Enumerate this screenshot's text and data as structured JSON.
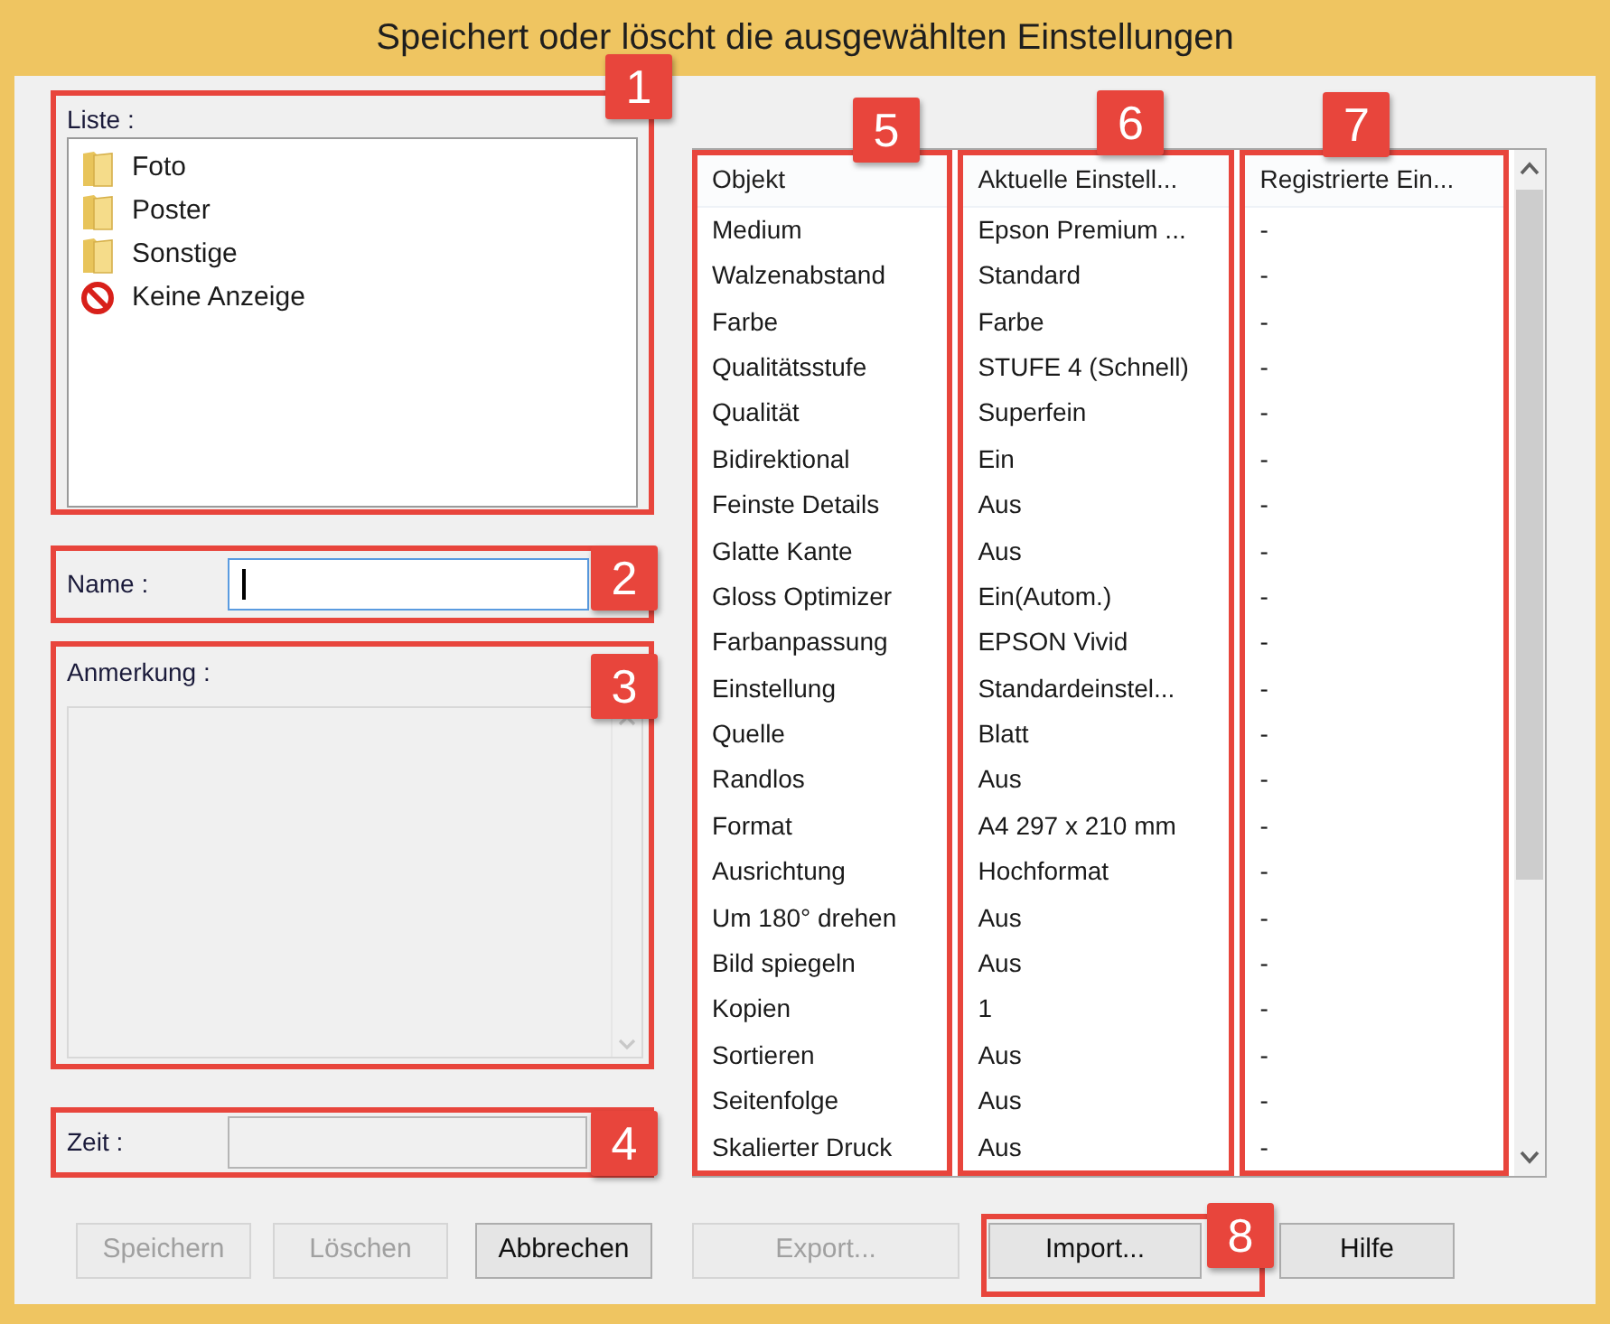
{
  "window": {
    "title": "Speichert oder löscht die ausgewählten Einstellungen"
  },
  "list": {
    "label": "Liste :",
    "items": [
      {
        "label": "Foto",
        "kind": "folder"
      },
      {
        "label": "Poster",
        "kind": "folder"
      },
      {
        "label": "Sonstige",
        "kind": "folder"
      },
      {
        "label": "Keine Anzeige",
        "kind": "blocked"
      }
    ]
  },
  "name": {
    "label": "Name :",
    "focused": true
  },
  "note": {
    "label": "Anmerkung :",
    "disabled": true
  },
  "time": {
    "label": "Zeit :",
    "disabled": true
  },
  "table": {
    "columns": [
      "Objekt",
      "Aktuelle Einstell...",
      "Registrierte Ein..."
    ],
    "rows": [
      [
        "Medium",
        "Epson Premium ...",
        "-"
      ],
      [
        "Walzenabstand",
        "Standard",
        "-"
      ],
      [
        "Farbe",
        "Farbe",
        "-"
      ],
      [
        "Qualitätsstufe",
        "STUFE 4 (Schnell)",
        "-"
      ],
      [
        "Qualität",
        "Superfein",
        "-"
      ],
      [
        "Bidirektional",
        "Ein",
        "-"
      ],
      [
        "Feinste Details",
        "Aus",
        "-"
      ],
      [
        "Glatte Kante",
        "Aus",
        "-"
      ],
      [
        "Gloss Optimizer",
        "Ein(Autom.)",
        "-"
      ],
      [
        "Farbanpassung",
        "EPSON Vivid",
        "-"
      ],
      [
        "Einstellung",
        "Standardeinstel...",
        "-"
      ],
      [
        "Quelle",
        "Blatt",
        "-"
      ],
      [
        "Randlos",
        "Aus",
        "-"
      ],
      [
        "Format",
        "A4 297 x 210 mm",
        "-"
      ],
      [
        "Ausrichtung",
        "Hochformat",
        "-"
      ],
      [
        "Um 180° drehen",
        "Aus",
        "-"
      ],
      [
        "Bild spiegeln",
        "Aus",
        "-"
      ],
      [
        "Kopien",
        "1",
        "-"
      ],
      [
        "Sortieren",
        "Aus",
        "-"
      ],
      [
        "Seitenfolge",
        "Aus",
        "-"
      ],
      [
        "Skalierter Druck",
        "Aus",
        "-"
      ]
    ]
  },
  "left_buttons": [
    {
      "label": "Speichern",
      "disabled": true
    },
    {
      "label": "Löschen",
      "disabled": true
    },
    {
      "label": "Abbrechen",
      "disabled": false
    }
  ],
  "right_buttons": [
    {
      "label": "Export...",
      "disabled": true
    },
    {
      "label": "Import...",
      "disabled": false
    },
    {
      "label": "Hilfe",
      "disabled": false
    }
  ],
  "callouts": [
    "1",
    "2",
    "3",
    "4",
    "5",
    "6",
    "7",
    "8"
  ]
}
